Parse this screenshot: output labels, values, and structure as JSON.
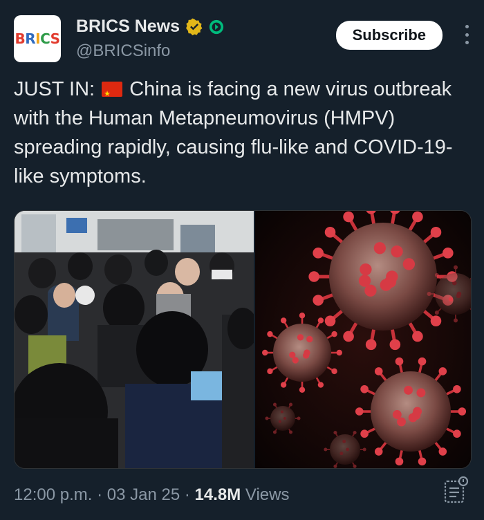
{
  "account": {
    "avatar_text": "BRICS",
    "display_name": "BRICS News",
    "handle": "@BRICSinfo"
  },
  "header": {
    "subscribe_label": "Subscribe"
  },
  "tweet": {
    "prefix": "JUST IN:",
    "flag": "🇨🇳",
    "text": "China is facing a new virus outbreak with the Human Metapneumovirus (HMPV) spreading rapidly, causing flu-like and COVID-19-like symptoms."
  },
  "meta": {
    "time": "12:00 p.m.",
    "separator": "·",
    "date": "03 Jan 25",
    "views_count": "14.8M",
    "views_label": "Views"
  },
  "icons": {
    "verified": "gold-verified-badge-icon",
    "affiliate": "green-affiliate-badge-icon",
    "more": "more-options-icon",
    "views": "post-analytics-icon"
  },
  "colors": {
    "background": "#15202b",
    "subscribe_bg": "#ffffff",
    "verified_gold": "#e2b719",
    "affiliate_green": "#00ba7c",
    "secondary_text": "#8b98a5"
  }
}
